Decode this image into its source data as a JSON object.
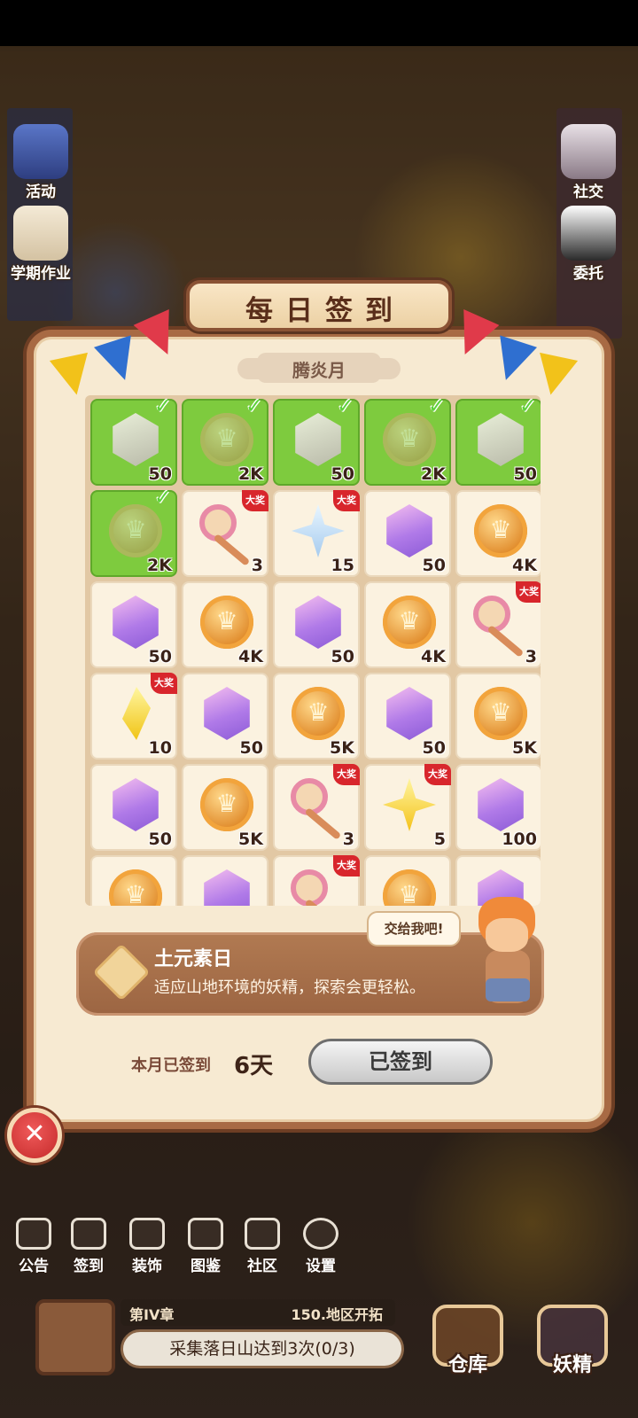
{
  "side_left": [
    {
      "label": "活动",
      "icon": "calendar-event-icon"
    },
    {
      "label": "学期作业",
      "icon": "homework-scroll-icon"
    }
  ],
  "side_right": [
    {
      "label": "社交",
      "icon": "social-icon"
    },
    {
      "label": "委托",
      "icon": "commission-icon"
    }
  ],
  "panel": {
    "title": "每日签到",
    "month": "腾炎月"
  },
  "rewards": [
    {
      "item": "gem",
      "count": "50",
      "checked": true,
      "grand": false
    },
    {
      "item": "coin",
      "count": "2K",
      "checked": true,
      "grand": false
    },
    {
      "item": "gem",
      "count": "50",
      "checked": true,
      "grand": false
    },
    {
      "item": "coin",
      "count": "2K",
      "checked": true,
      "grand": false
    },
    {
      "item": "gem",
      "count": "50",
      "checked": true,
      "grand": false
    },
    {
      "item": "coin",
      "count": "2K",
      "checked": true,
      "grand": false
    },
    {
      "item": "key",
      "count": "3",
      "checked": false,
      "grand": true
    },
    {
      "item": "star",
      "count": "15",
      "checked": false,
      "grand": true
    },
    {
      "item": "gem",
      "count": "50",
      "checked": false,
      "grand": false
    },
    {
      "item": "coin",
      "count": "4K",
      "checked": false,
      "grand": false
    },
    {
      "item": "gem",
      "count": "50",
      "checked": false,
      "grand": false
    },
    {
      "item": "coin",
      "count": "4K",
      "checked": false,
      "grand": false
    },
    {
      "item": "gem",
      "count": "50",
      "checked": false,
      "grand": false
    },
    {
      "item": "coin",
      "count": "4K",
      "checked": false,
      "grand": false
    },
    {
      "item": "key",
      "count": "3",
      "checked": false,
      "grand": true
    },
    {
      "item": "shard",
      "count": "10",
      "checked": false,
      "grand": true
    },
    {
      "item": "gem",
      "count": "50",
      "checked": false,
      "grand": false
    },
    {
      "item": "coin",
      "count": "5K",
      "checked": false,
      "grand": false
    },
    {
      "item": "gem",
      "count": "50",
      "checked": false,
      "grand": false
    },
    {
      "item": "coin",
      "count": "5K",
      "checked": false,
      "grand": false
    },
    {
      "item": "gem",
      "count": "50",
      "checked": false,
      "grand": false
    },
    {
      "item": "coin",
      "count": "5K",
      "checked": false,
      "grand": false
    },
    {
      "item": "key",
      "count": "3",
      "checked": false,
      "grand": true
    },
    {
      "item": "star-yellow",
      "count": "5",
      "checked": false,
      "grand": true
    },
    {
      "item": "gem",
      "count": "100",
      "checked": false,
      "grand": false
    },
    {
      "item": "coin",
      "count": "",
      "checked": false,
      "grand": false
    },
    {
      "item": "gem",
      "count": "",
      "checked": false,
      "grand": false
    },
    {
      "item": "key",
      "count": "",
      "checked": false,
      "grand": true
    },
    {
      "item": "coin",
      "count": "",
      "checked": false,
      "grand": false
    },
    {
      "item": "gem",
      "count": "",
      "checked": false,
      "grand": false
    }
  ],
  "grand_badge": "大奖",
  "element_day": {
    "name": "土元素日",
    "desc": "适应山地环境的妖精，探索会更轻松。",
    "bubble": "交给我吧!"
  },
  "signin": {
    "count_label": "本月已签到",
    "count_value": "6天",
    "button_label": "已签到"
  },
  "toolbar": [
    {
      "label": "公告",
      "icon": "announcement-icon"
    },
    {
      "label": "签到",
      "icon": "signin-calendar-icon"
    },
    {
      "label": "装饰",
      "icon": "decoration-icon"
    },
    {
      "label": "图鉴",
      "icon": "book-icon"
    },
    {
      "label": "社区",
      "icon": "community-home-icon"
    },
    {
      "label": "设置",
      "icon": "gear-icon"
    }
  ],
  "quest": {
    "chapter": "第IV章",
    "region": "150.地区开拓",
    "task": "采集落日山达到3次(0/3)"
  },
  "bottom": [
    {
      "label": "仓库",
      "icon": "warehouse-chest-icon"
    },
    {
      "label": "妖精",
      "icon": "fairy-icon"
    }
  ]
}
